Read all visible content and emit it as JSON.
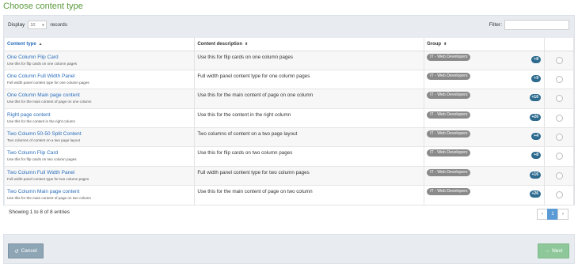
{
  "page": {
    "title": "Choose content type"
  },
  "controls": {
    "display_label": "Display",
    "display_value": "10",
    "records_label": "records",
    "filter_label": "Filter:",
    "filter_value": ""
  },
  "table": {
    "columns": [
      "Content type",
      "Content description",
      "Group"
    ],
    "sort_icons": {
      "asc": "▲",
      "both": "⬍"
    },
    "rows": [
      {
        "name": "One Column Flip Card",
        "sub": "Use this for flip cards on one column pages",
        "desc": "Use this for flip cards on one column pages",
        "group": "IT - Web Developers",
        "count": "+8"
      },
      {
        "name": "One Column Full Width Panel",
        "sub": "Full width panel content type for one column pages",
        "desc": "Full width panel content type for one column pages",
        "group": "IT - Web Developers",
        "count": "+9"
      },
      {
        "name": "One Column Main page content",
        "sub": "Use this for the main content of page on one column",
        "desc": "Use this for the main content of page on one column",
        "group": "IT - Web Developers",
        "count": "+16"
      },
      {
        "name": "Right page content",
        "sub": "Use this for the content in the right column",
        "desc": "Use this for the content in the right column",
        "group": "IT - Web Developers",
        "count": "+26"
      },
      {
        "name": "Two Column 50-50 Split Content",
        "sub": "Two columns of content on a two page layout",
        "desc": "Two columns of content on a two page layout",
        "group": "IT - Web Developers",
        "count": "+4"
      },
      {
        "name": "Two Column Flip Card",
        "sub": "Use this for flip cards on two column pages",
        "desc": "Use this for flip cards on two column pages",
        "group": "IT - Web Developers",
        "count": "+8"
      },
      {
        "name": "Two Column Full Width Panel",
        "sub": "Full width panel content type for two column pages",
        "desc": "Full width panel content type for two column pages",
        "group": "IT - Web Developers",
        "count": "+16"
      },
      {
        "name": "Two Column Main page content",
        "sub": "Use this for the main content of page on two column",
        "desc": "Use this for the main content of page on two column",
        "group": "IT - Web Developers",
        "count": "+26"
      }
    ]
  },
  "summary": {
    "showing": "Showing 1 to 8 of 8 entries"
  },
  "pagination": {
    "prev": "‹",
    "page": "1",
    "next": "›"
  },
  "footer": {
    "cancel_label": "Cancel",
    "cancel_icon": "↺",
    "next_label": "Next",
    "next_icon": "→"
  },
  "colors": {
    "title": "#5a9a3c",
    "link": "#2a6ebb",
    "badge_group": "#8a8a8a",
    "badge_count": "#2d6b8f",
    "cancel_btn": "#8ea5b5",
    "next_btn": "#8ec89a"
  }
}
